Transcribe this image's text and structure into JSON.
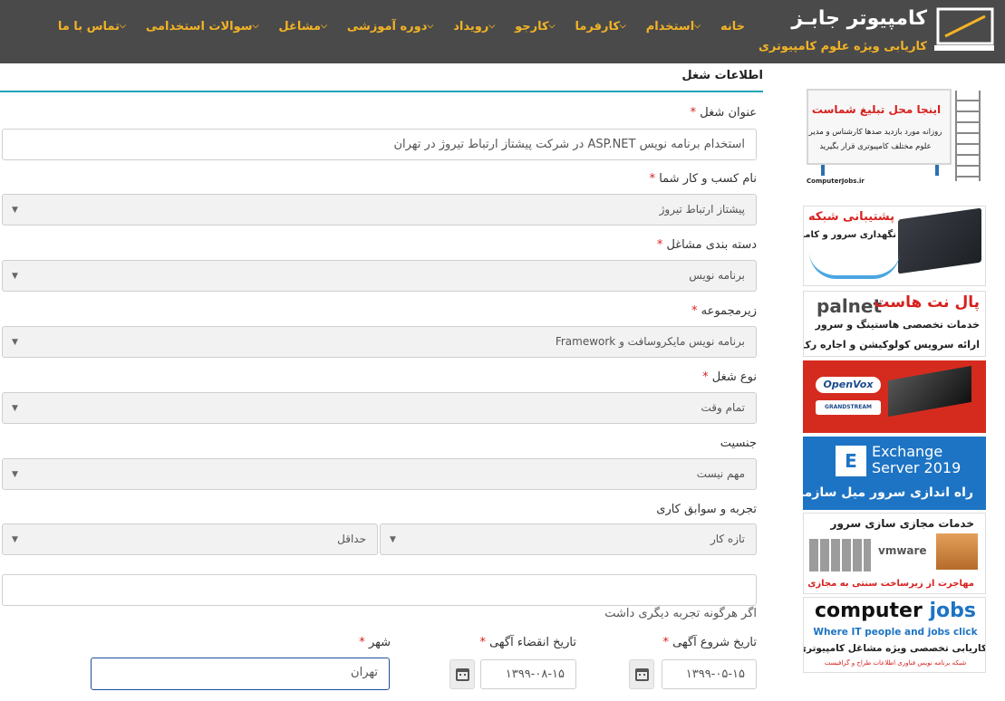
{
  "brand": {
    "title": "کامپیوتر جابـز",
    "subtitle": "کاریابی ویژه علوم کامپیوتری"
  },
  "menu": [
    {
      "label": "خانه",
      "has_dropdown": false
    },
    {
      "label": "استخدام",
      "has_dropdown": true
    },
    {
      "label": "کارفرما",
      "has_dropdown": true
    },
    {
      "label": "کارجو",
      "has_dropdown": true
    },
    {
      "label": "رویداد",
      "has_dropdown": true
    },
    {
      "label": "دوره آموزشی",
      "has_dropdown": true
    },
    {
      "label": "مشاغل",
      "has_dropdown": true
    },
    {
      "label": "سوالات استخدامی",
      "has_dropdown": true
    },
    {
      "label": "تماس با ما",
      "has_dropdown": true
    }
  ],
  "form": {
    "section_title": "اطلاعات شغل",
    "required_mark": "*",
    "job_title": {
      "label": "عنوان شغل",
      "value": "استخدام برنامه نویس ASP.NET در شرکت پیشتاز ارتباط تیروژ در تهران"
    },
    "business_name": {
      "label": "نام کسب و کار شما",
      "value": "پیشتاز ارتباط تیروژ"
    },
    "category": {
      "label": "دسته بندی مشاغل",
      "value": "برنامه نویس"
    },
    "subcategory": {
      "label": "زیرمجموعه",
      "value": "برنامه نویس مایکروسافت و Framework"
    },
    "job_type": {
      "label": "نوع شغل",
      "value": "تمام وقت"
    },
    "gender": {
      "label": "جنسیت",
      "value": "مهم نیست"
    },
    "experience": {
      "label": "تجربه و سوابق کاری",
      "level_value": "تازه کار",
      "minimum_value": "حداقل"
    },
    "other_experience": {
      "value": "",
      "hint": "اگر هرگونه تجربه دیگری داشت"
    },
    "start_date": {
      "label": "تاریخ شروع آگهی",
      "value": "۱۳۹۹-۰۵-۱۵"
    },
    "expire_date": {
      "label": "تاریخ انقضاء آگهی",
      "value": "۱۳۹۹-۰۸-۱۵"
    },
    "city": {
      "label": "شهر",
      "value": "تهران"
    }
  },
  "ads": {
    "billboard": {
      "title": "اینجا محل تبلیغ شماست",
      "text": "روزانه مورد بازدید صدها کارشناس و مدیر علوم مختلف کامپیوتری قرار بگیرید",
      "brand": "ComputerJobs.ir"
    },
    "network": {
      "title": "پشتیبانی شبکه",
      "subtitle": "نگهداری سرور و کامپیوتر"
    },
    "palnet": {
      "logo": "palnet",
      "title": "پال نت هاست",
      "line1": "خدمات تخصصی هاستینگ و سرور",
      "line2": "ارائه سرویس کولوکیشن و اجاره رک"
    },
    "openvox": {
      "brand1": "OpenVox",
      "brand2": "GRANDSTREAM"
    },
    "exchange": {
      "icon_letter": "E",
      "title_line1": "Exchange",
      "title_line2": "Server 2019",
      "subtitle": "راه اندازی سرور میل سازمانی"
    },
    "vmware": {
      "title": "خدمات مجازی سازی سرور",
      "brand": "vmware",
      "subtitle": "مهاجرت از زیرساخت سنتی به مجازی"
    },
    "computerjobs": {
      "word1": "computer",
      "word2": "jobs",
      "tagline": "Where IT people and jobs click",
      "line1": "کاریابی تخصصی ویژه مشاغل کامپیوتری",
      "line2": "شبکه  برنامه نویس  فناوری اطلاعات  طراح و گرافیست"
    }
  },
  "colors": {
    "header_bg": "#4a4a4a",
    "accent": "#f2b325",
    "rule": "#1aa3b4",
    "required": "#d6211e"
  }
}
